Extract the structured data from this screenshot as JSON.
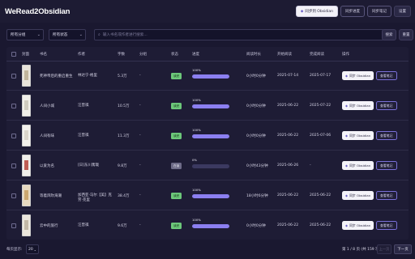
{
  "app": {
    "title": "WeRead2Obsidian"
  },
  "toolbar": {
    "sync_obsidian": "同步到 Obsidian",
    "sync_progress": "同步进度",
    "sync_notes": "同步笔记",
    "settings": "设置"
  },
  "filters": {
    "category": "所有分组",
    "status": "所有状态",
    "search_placeholder": "输入书名或作者进行搜索...",
    "search_button": "搜索",
    "reset_button": "重置"
  },
  "table": {
    "headers": {
      "cover": "封面",
      "title": "书名",
      "author": "作者",
      "words": "字数",
      "group": "分组",
      "status": "状态",
      "progress": "进度",
      "read_time": "阅读时长",
      "start_date": "开始阅读",
      "finish_date": "完成阅读",
      "actions": "操作"
    },
    "rows": [
      {
        "title": "死神帝后的重启重生",
        "author": "林达宁·格里",
        "words": "5.3万",
        "group": "-",
        "status": "读完",
        "status_kind": "done",
        "progress_text": "100%",
        "progress": 1.0,
        "read_time": "0小时0分钟",
        "start": "2025-07-14",
        "finish": "2025-07-17",
        "cover_color": "#e9e4da",
        "cover_accent": "#b7a98c",
        "sync_label": "同步 Obsidian",
        "note_label": "查看笔记"
      },
      {
        "title": "人间小城",
        "author": "汪曾祺",
        "words": "10.5万",
        "group": "-",
        "status": "读完",
        "status_kind": "done",
        "progress_text": "100%",
        "progress": 1.0,
        "read_time": "0小时0分钟",
        "start": "2025-06-22",
        "finish": "2025-07-22",
        "cover_color": "#f1efe9",
        "cover_accent": "#c7c2b4",
        "sync_label": "同步 Obsidian",
        "note_label": "查看笔记"
      },
      {
        "title": "人间有味",
        "author": "汪曾祺",
        "words": "11.3万",
        "group": "-",
        "status": "读完",
        "status_kind": "done",
        "progress_text": "100%",
        "progress": 1.0,
        "read_time": "0小时0分钟",
        "start": "2025-06-22",
        "finish": "2025-07-06",
        "cover_color": "#f3f1ec",
        "cover_accent": "#d5cfc2",
        "sync_label": "同步 Obsidian",
        "note_label": "查看笔记"
      },
      {
        "title": "以爱为名",
        "author": "[日]东川篤哉",
        "words": "9.8万",
        "group": "-",
        "status": "在读",
        "status_kind": "reading",
        "progress_text": "0%",
        "progress": 0.0,
        "read_time": "0小时43分钟",
        "start": "2025-06-26",
        "finish": "-",
        "cover_color": "#f0eeea",
        "cover_accent": "#b3392f",
        "sync_label": "同步 Obsidian",
        "note_label": "查看笔记"
      },
      {
        "title": "等着风吹海潮",
        "author": "加西亚·马尔【美】克劳·克里",
        "words": "38.4万",
        "group": "-",
        "status": "读完",
        "status_kind": "done",
        "progress_text": "100%",
        "progress": 1.0,
        "read_time": "18小时6分钟",
        "start": "2025-06-22",
        "finish": "2025-06-22",
        "cover_color": "#e7d9c0",
        "cover_accent": "#c49a5a",
        "sync_label": "同步 Obsidian",
        "note_label": "查看笔记"
      },
      {
        "title": "云中的旅行",
        "author": "汪曾祺",
        "words": "9.6万",
        "group": "-",
        "status": "读完",
        "status_kind": "done",
        "progress_text": "100%",
        "progress": 1.0,
        "read_time": "0小时0分钟",
        "start": "2025-06-22",
        "finish": "2025-06-22",
        "cover_color": "#ebe6dc",
        "cover_accent": "#b8ad98",
        "sync_label": "同步 Obsidian",
        "note_label": "查看笔记"
      }
    ]
  },
  "footer": {
    "per_page_label": "每页显示:",
    "per_page_value": "20",
    "page_info": "第 1 / 8 页 (共 159 项)",
    "prev": "上一页",
    "next": "下一页"
  },
  "colors": {
    "accent": "#8b7ff0",
    "done_badge": "#6cc77a",
    "background": "#1a1830"
  }
}
